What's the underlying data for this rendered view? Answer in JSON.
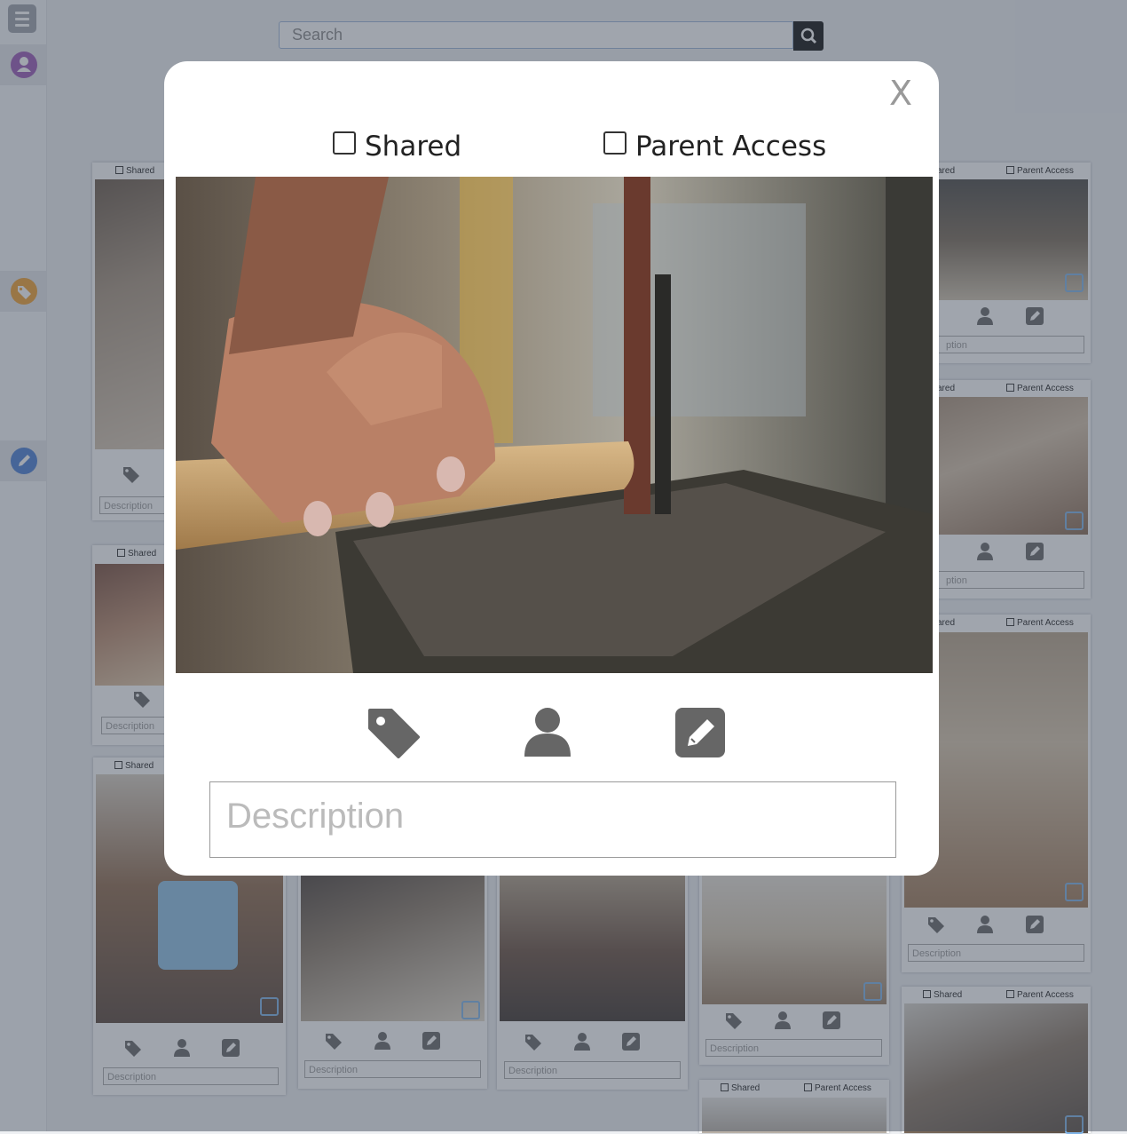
{
  "search": {
    "placeholder": "Search"
  },
  "cards": {
    "shared_label": "Shared",
    "parent_label": "Parent Access",
    "description_placeholder": "Description"
  },
  "side_cards": {
    "r1_shared": "ared",
    "r1_desc": "ption",
    "r2_shared": "ared",
    "r2_desc": "ption",
    "r3_shared": "ared"
  },
  "modal": {
    "close_label": "X",
    "shared_label": "Shared",
    "parent_label": "Parent Access",
    "description_placeholder": "Description"
  },
  "colors": {
    "profile": "#9b59b6",
    "tag": "#f0a030",
    "edit": "#4a7fd4",
    "icon_gray": "#666666"
  }
}
